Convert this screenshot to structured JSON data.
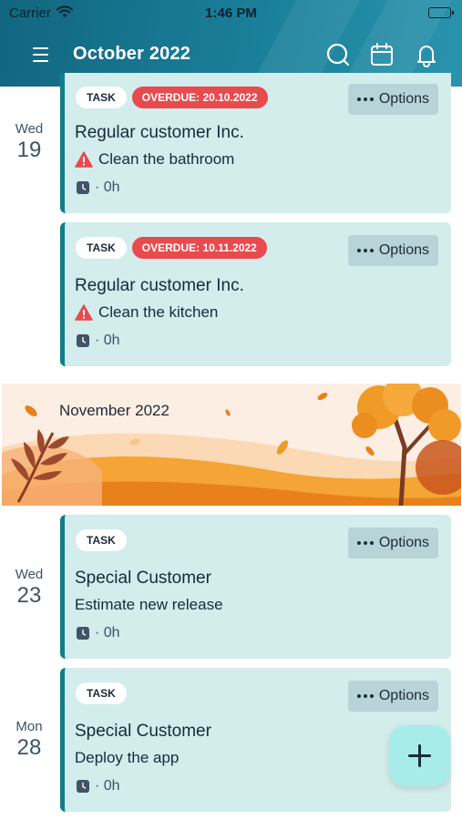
{
  "status_bar": {
    "carrier": "Carrier",
    "time": "1:46 PM"
  },
  "navbar": {
    "title": "October 2022",
    "icons": [
      "menu-icon",
      "search-icon",
      "calendar-icon",
      "bell-icon"
    ]
  },
  "days": [
    {
      "dow": "Wed",
      "day": "19"
    },
    {
      "dow": "Wed",
      "day": "23"
    },
    {
      "dow": "Mon",
      "day": "28"
    }
  ],
  "cards": [
    {
      "badge": "TASK",
      "overdue": "OVERDUE: 20.10.2022",
      "options": "Options",
      "customer": "Regular customer Inc.",
      "task": "Clean the bathroom",
      "warning": true,
      "duration": "· 0h"
    },
    {
      "badge": "TASK",
      "overdue": "OVERDUE: 10.11.2022",
      "options": "Options",
      "customer": "Regular customer Inc.",
      "task": "Clean the kitchen",
      "warning": true,
      "duration": "· 0h"
    },
    {
      "badge": "TASK",
      "overdue": "",
      "options": "Options",
      "customer": "Special Customer",
      "task": "Estimate new release",
      "warning": false,
      "duration": "· 0h"
    },
    {
      "badge": "TASK",
      "overdue": "",
      "options": "Options",
      "customer": "Special Customer",
      "task": "Deploy the app",
      "warning": false,
      "duration": "· 0h"
    }
  ],
  "banner": {
    "title": "November 2022"
  },
  "fab": {
    "icon": "plus-icon"
  },
  "colors": {
    "header": "#1a7f9a",
    "card_bg": "#d3ecec",
    "card_accent": "#0f7f8a",
    "overdue": "#e94a4e",
    "fab": "#a8ecea"
  }
}
